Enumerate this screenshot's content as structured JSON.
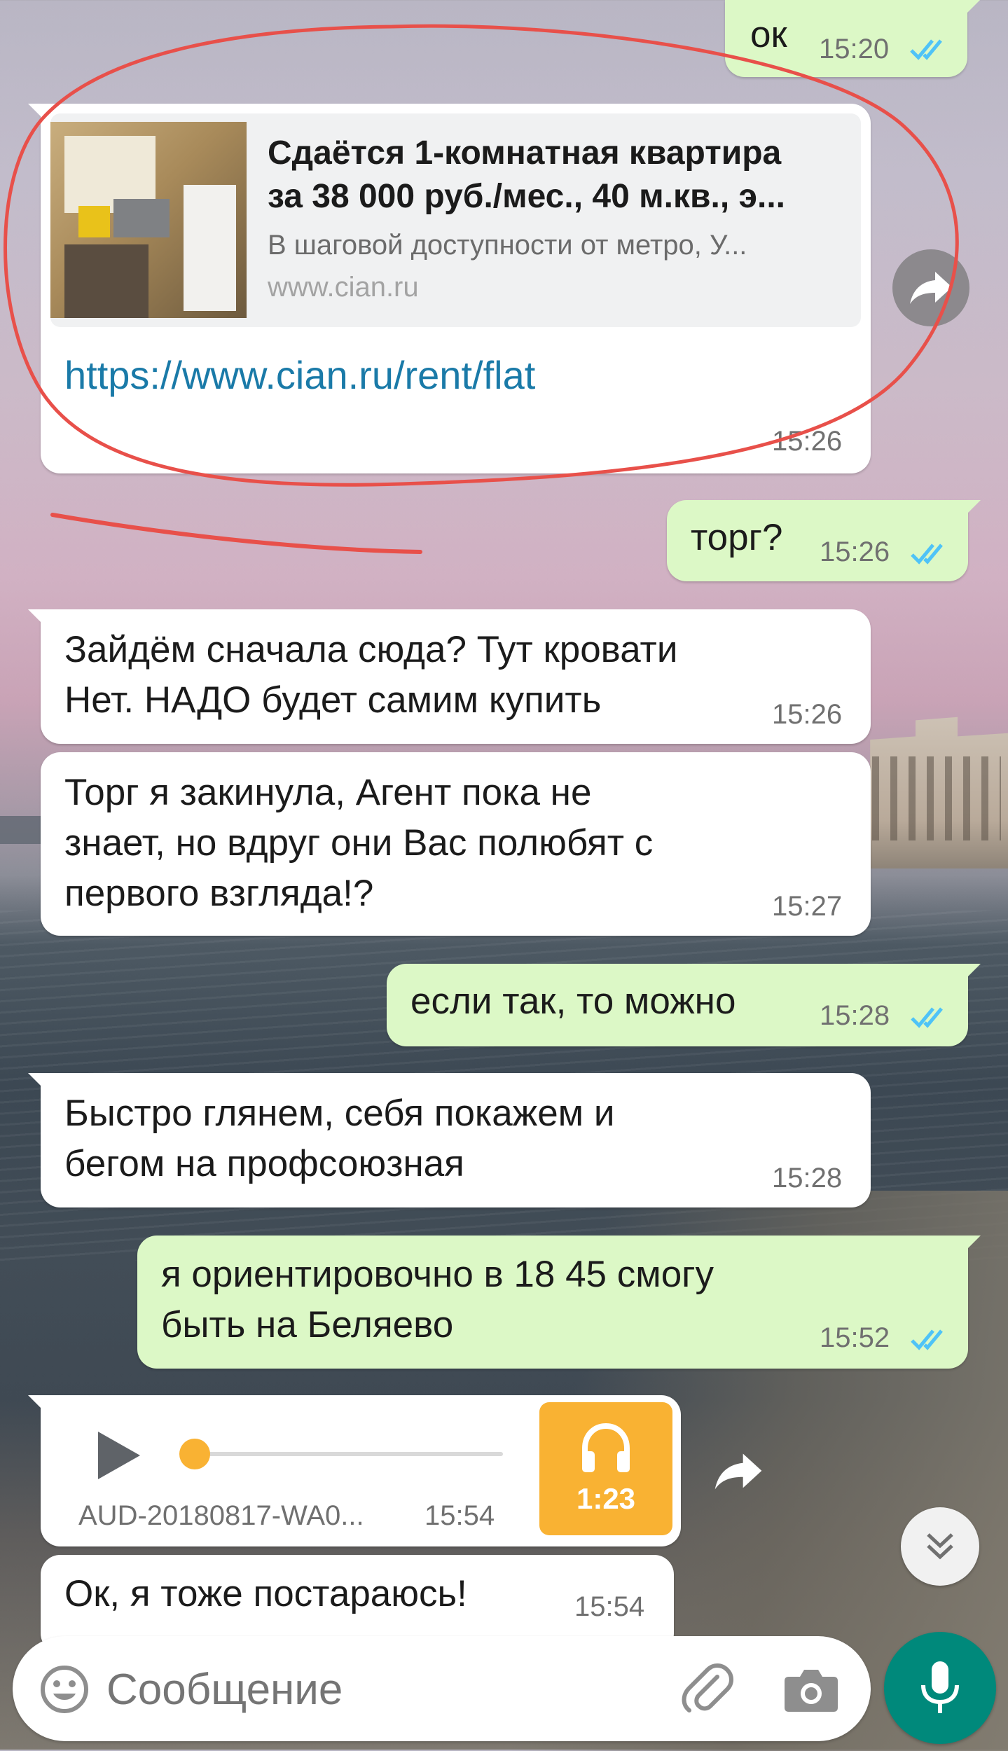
{
  "messages": {
    "ok": {
      "text": "ок",
      "time": "15:20",
      "status": "read"
    },
    "link": {
      "preview_title_line1": "Сдаётся 1-комнатная квартира",
      "preview_title_line2": "за 38 000 руб./мес., 40 м.кв., э...",
      "preview_description": "В шаговой доступности от метро, У...",
      "preview_site": "www.cian.ru",
      "url": "https://www.cian.ru/rent/flat",
      "time": "15:26"
    },
    "torg": {
      "text": "торг?",
      "time": "15:26",
      "status": "read"
    },
    "zaydem": {
      "text": "Зайдём сначала сюда? Тут кровати\nНет. НАДО будет самим купить",
      "time": "15:26"
    },
    "torg_agent": {
      "text": "Торг я закинула, Агент пока не\nзнает, но вдруг они Вас полюбят с\nпервого взгляда!?",
      "time": "15:27"
    },
    "esli_tak": {
      "text": "если так, то можно",
      "time": "15:28",
      "status": "read"
    },
    "bystro": {
      "text": "Быстро глянем, себя покажем и\nбегом на профсоюзная",
      "time": "15:28"
    },
    "orient": {
      "text": "я ориентировочно в 18 45 смогу\nбыть на Беляево",
      "time": "15:52",
      "status": "read"
    },
    "audio": {
      "filename": "AUD-20180817-WA0...",
      "time": "15:54",
      "duration": "1:23",
      "progress": 0
    },
    "ok_too": {
      "text": "Ок, я тоже постараюсь!",
      "time": "15:54"
    }
  },
  "composer": {
    "placeholder": "Сообщение"
  },
  "icons": {
    "forward": "forward-icon",
    "scroll_down": "chevron-double-down-icon",
    "emoji": "emoji-icon",
    "attach": "paperclip-icon",
    "camera": "camera-icon",
    "mic": "microphone-icon",
    "headphones": "headphones-icon",
    "play": "play-icon"
  },
  "colors": {
    "incoming_bubble": "#ffffff",
    "outgoing_bubble": "#dcf8c6",
    "read_ticks": "#4fc3f7",
    "link": "#1a7aa8",
    "audio_accent": "#f9b233",
    "mic_button": "#00897b",
    "annotation": "#e8504a"
  }
}
